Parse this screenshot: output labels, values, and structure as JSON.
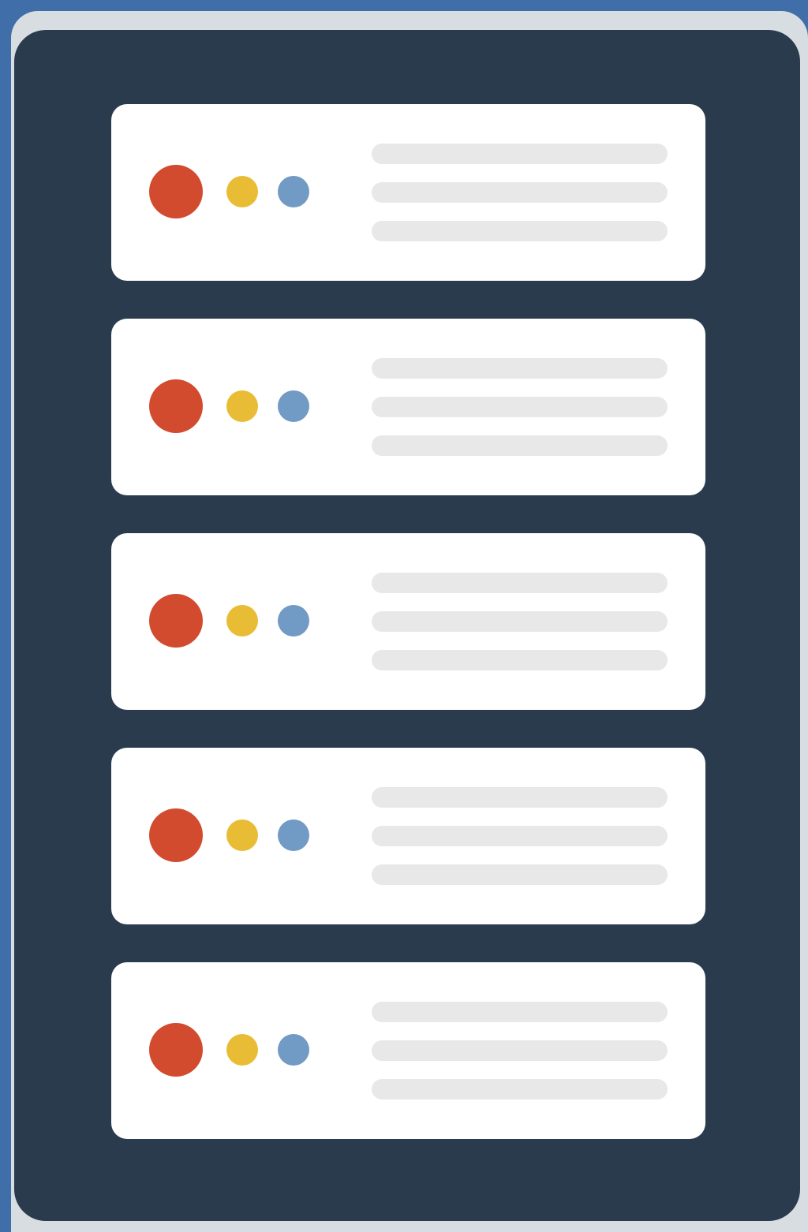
{
  "colors": {
    "background": "#3f6ea8",
    "frame": "#d8dde2",
    "cabinet": "#2a3b4e",
    "unit": "#ffffff",
    "bar": "#e8e8e8",
    "light_red": "#d24b2e",
    "light_yellow": "#e8bd35",
    "light_blue": "#719ac4"
  },
  "rack_units": [
    {
      "icons": [
        "red-status-light-icon",
        "yellow-status-light-icon",
        "blue-status-light-icon"
      ]
    },
    {
      "icons": [
        "red-status-light-icon",
        "yellow-status-light-icon",
        "blue-status-light-icon"
      ]
    },
    {
      "icons": [
        "red-status-light-icon",
        "yellow-status-light-icon",
        "blue-status-light-icon"
      ]
    },
    {
      "icons": [
        "red-status-light-icon",
        "yellow-status-light-icon",
        "blue-status-light-icon"
      ]
    },
    {
      "icons": [
        "red-status-light-icon",
        "yellow-status-light-icon",
        "blue-status-light-icon"
      ]
    }
  ]
}
